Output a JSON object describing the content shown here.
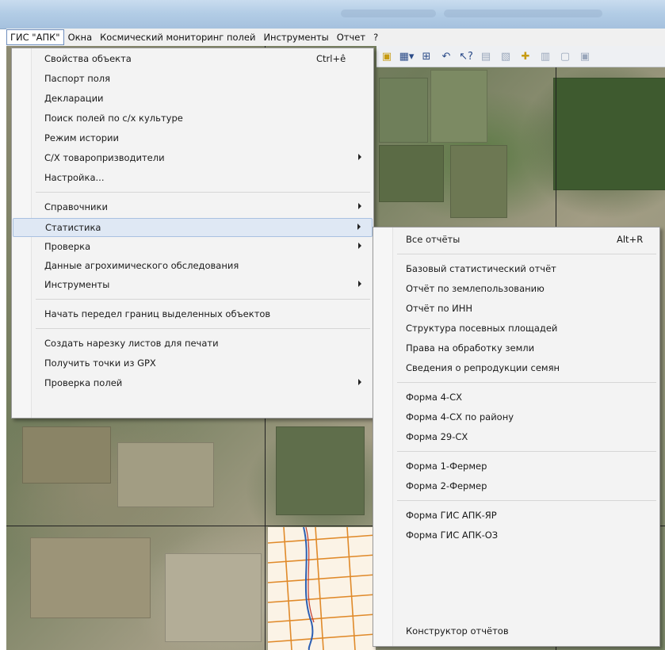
{
  "menubar": {
    "items": [
      "ГИС \"АПК\"",
      "Окна",
      "Космический мониторинг полей",
      "Инструменты",
      "Отчет",
      "?"
    ]
  },
  "toolbar": {
    "icons": [
      "layers-icon",
      "grid-dropdown-icon",
      "ruler-icon",
      "undo-icon",
      "help-cursor-icon",
      "copy-icon",
      "paste-icon",
      "new-object-icon",
      "cut-icon",
      "frame-icon",
      "settings-icon"
    ]
  },
  "main_menu": {
    "items": [
      {
        "label": "Свойства объекта",
        "shortcut": "Ctrl+ê"
      },
      {
        "label": "Паспорт поля"
      },
      {
        "label": "Декларации"
      },
      {
        "label": "Поиск полей по с/х культуре"
      },
      {
        "label": "Режим истории"
      },
      {
        "label": "С/Х товаропризводители"
      },
      {
        "label": "Настройка..."
      },
      {
        "label": "Справочники"
      },
      {
        "label": "Статистика"
      },
      {
        "label": "Проверка"
      },
      {
        "label": "Данные агрохимического обследования"
      },
      {
        "label": "Инструменты"
      },
      {
        "label": "Начать передел границ выделенных объектов"
      },
      {
        "label": "Создать нарезку листов для печати"
      },
      {
        "label": "Получить точки из GPX"
      },
      {
        "label": "Проверка полей"
      }
    ]
  },
  "sub_menu": {
    "items": [
      {
        "label": "Все отчёты",
        "shortcut": "Alt+R"
      },
      {
        "label": "Базовый статистический отчёт"
      },
      {
        "label": "Отчёт по землепользованию"
      },
      {
        "label": "Отчёт по ИНН"
      },
      {
        "label": "Структура посевных площадей"
      },
      {
        "label": "Права на обработку земли"
      },
      {
        "label": "Сведения о репродукции семян"
      },
      {
        "label": "Форма 4-СХ"
      },
      {
        "label": "Форма 4-СХ по району"
      },
      {
        "label": "Форма 29-СХ"
      },
      {
        "label": "Форма 1-Фермер"
      },
      {
        "label": "Форма 2-Фермер"
      },
      {
        "label": "Форма ГИС АПК-ЯР"
      },
      {
        "label": "Форма ГИС АПК-ОЗ"
      },
      {
        "label": "Конструктор отчётов"
      }
    ]
  },
  "colors": {
    "menu_bg": "#f3f3f3",
    "highlight_bg": "#dfe8f4",
    "highlight_border": "#a9c1e0",
    "titlebar": "#b3cde6"
  }
}
